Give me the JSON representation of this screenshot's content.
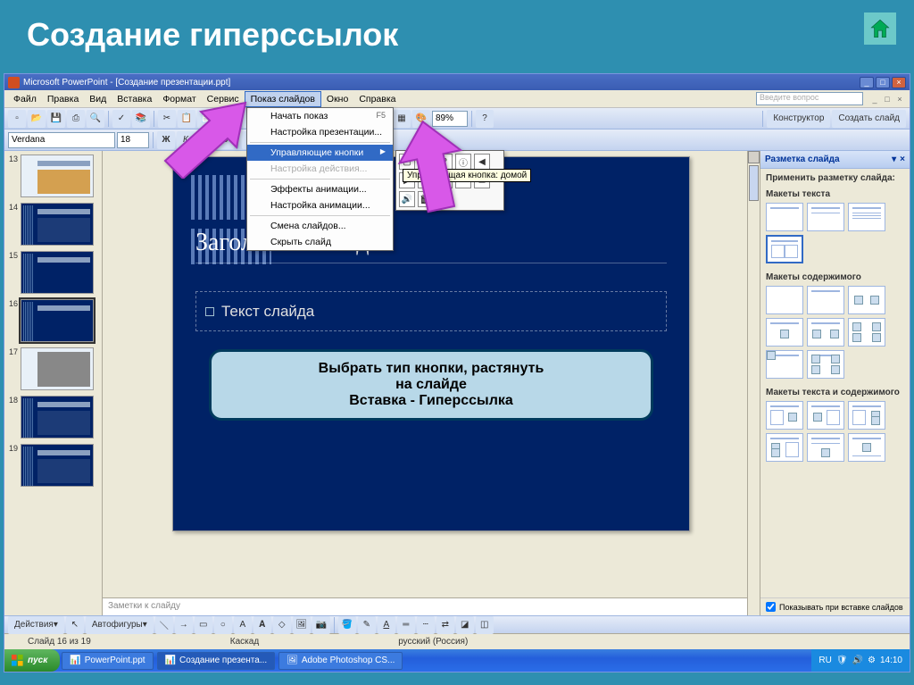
{
  "outer": {
    "title": "Создание гиперссылок"
  },
  "titlebar": {
    "text": "Microsoft PowerPoint - [Создание презентации.ppt]"
  },
  "menubar": {
    "items": [
      "Файл",
      "Правка",
      "Вид",
      "Вставка",
      "Формат",
      "Сервис",
      "Показ слайдов",
      "Окно",
      "Справка"
    ],
    "active_index": 6,
    "help_placeholder": "Введите вопрос"
  },
  "toolbar": {
    "zoom": "89%",
    "constructor": "Конструктор",
    "new_slide": "Создать слайд"
  },
  "format_bar": {
    "font": "Verdana",
    "size": "18"
  },
  "dropdown": {
    "items": [
      {
        "label": "Начать показ",
        "shortcut": "F5",
        "disabled": false
      },
      {
        "label": "Настройка презентации...",
        "disabled": false
      },
      {
        "sep": true
      },
      {
        "label": "Управляющие кнопки",
        "arrow": true,
        "hover": true
      },
      {
        "label": "Настройка действия...",
        "disabled": true
      },
      {
        "sep": true
      },
      {
        "label": "Эффекты анимации...",
        "disabled": false
      },
      {
        "label": "Настройка анимации...",
        "disabled": false
      },
      {
        "sep": true
      },
      {
        "label": "Смена слайдов...",
        "disabled": false
      },
      {
        "label": "Скрыть слайд",
        "disabled": false
      }
    ]
  },
  "flyout_tooltip": "Управляющая кнопка: домой",
  "thumbs": [
    "13",
    "14",
    "15",
    "16",
    "17",
    "18",
    "19"
  ],
  "thumb_selected": "16",
  "slide": {
    "heading": "Заголовок слайда",
    "subtext": "Текст слайда"
  },
  "callout": {
    "line1": "Выбрать тип кнопки, растянуть",
    "line2": "на слайде",
    "line3": "Вставка - Гиперссылка"
  },
  "notes": "Заметки к слайду",
  "taskpane": {
    "title": "Разметка слайда",
    "apply": "Применить разметку слайда:",
    "section1": "Макеты текста",
    "section2": "Макеты содержимого",
    "section3": "Макеты текста и содержимого",
    "footer_check": "Показывать при вставке слайдов"
  },
  "drawbar": {
    "actions": "Действия",
    "autoshapes": "Автофигуры"
  },
  "status": {
    "slide": "Слайд 16 из 19",
    "mode": "Каскад",
    "lang": "русский (Россия)"
  },
  "taskbar": {
    "start": "пуск",
    "tasks": [
      "PowerPoint.ppt",
      "Создание презента...",
      "Adobe Photoshop CS..."
    ],
    "lang": "RU",
    "time": "14:10"
  }
}
